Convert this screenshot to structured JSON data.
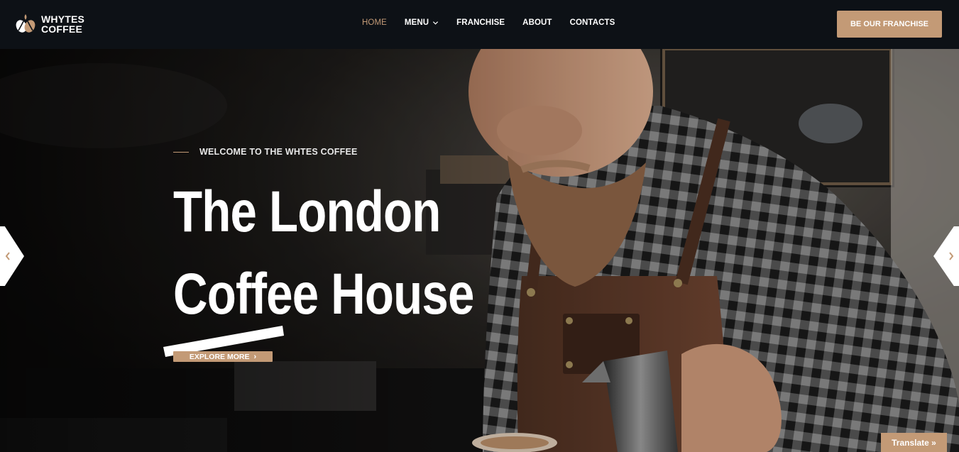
{
  "brand": {
    "line1": "WHYTES",
    "line2": "COFFEE"
  },
  "nav": {
    "items": [
      {
        "label": "HOME",
        "active": true
      },
      {
        "label": "MENU",
        "has_dropdown": true
      },
      {
        "label": "FRANCHISE"
      },
      {
        "label": "ABOUT"
      },
      {
        "label": "CONTACTS"
      }
    ]
  },
  "header_cta": {
    "label": "BE OUR FRANCHISE"
  },
  "hero": {
    "eyebrow": "WELCOME TO THE WHTES COFFEE",
    "headline_line1": "The London",
    "headline_line2": "Coffee House",
    "button_label": "EXPLORE MORE",
    "prev_icon": "chevron-left-icon",
    "next_icon": "chevron-right-icon"
  },
  "translate": {
    "label": "Translate »"
  },
  "colors": {
    "accent": "#c39a76",
    "header_bg": "#0d1116",
    "text": "#ffffff"
  }
}
